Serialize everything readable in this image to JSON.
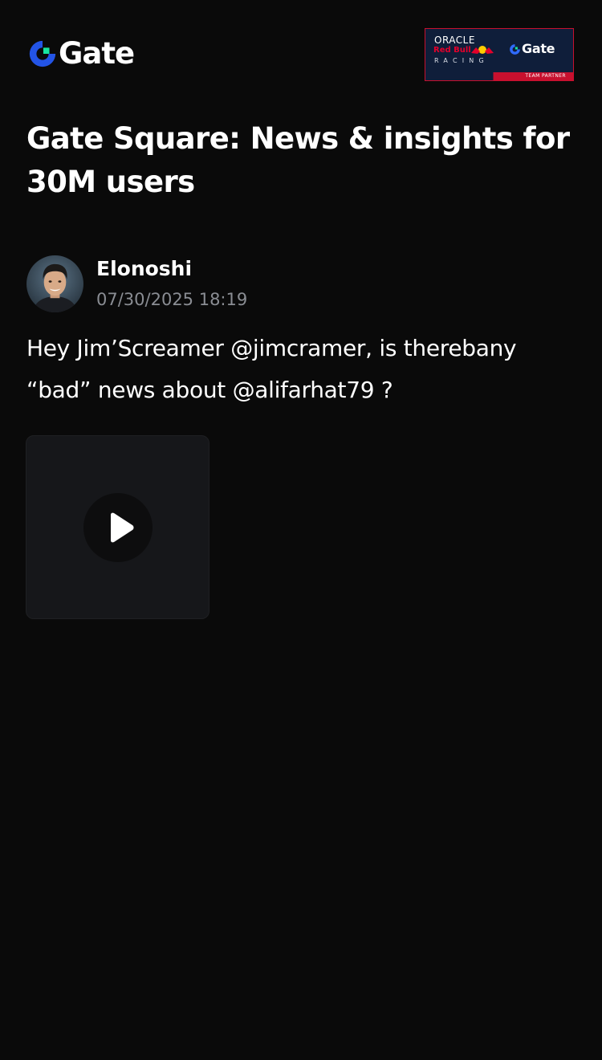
{
  "header": {
    "brand_name": "Gate",
    "brand_icon": "gate-logo-icon",
    "partner_banner": {
      "oracle_label": "ORACLE",
      "redbull_label": "Red Bull",
      "racing_label": "RACING",
      "gate_label": "Gate",
      "strip_label": "TEAM PARTNER",
      "colors": {
        "navy": "#0f1e3a",
        "red": "#c8102e"
      }
    }
  },
  "page": {
    "title": "Gate Square: News & insights for 30M users"
  },
  "post": {
    "author": {
      "name": "Elonoshi",
      "avatar_icon": "user-avatar"
    },
    "timestamp": "07/30/2025 18:19",
    "body": "Hey Jim’Screamer @jimcramer, is therebany “bad” news about @alifarhat79 ?",
    "media": {
      "type": "video",
      "icon": "play-icon"
    }
  },
  "colors": {
    "background": "#0a0a0a",
    "brand_blue": "#2354e6",
    "brand_green": "#17e6a1",
    "muted_text": "#8a8d93",
    "card_bg": "#16171a"
  }
}
